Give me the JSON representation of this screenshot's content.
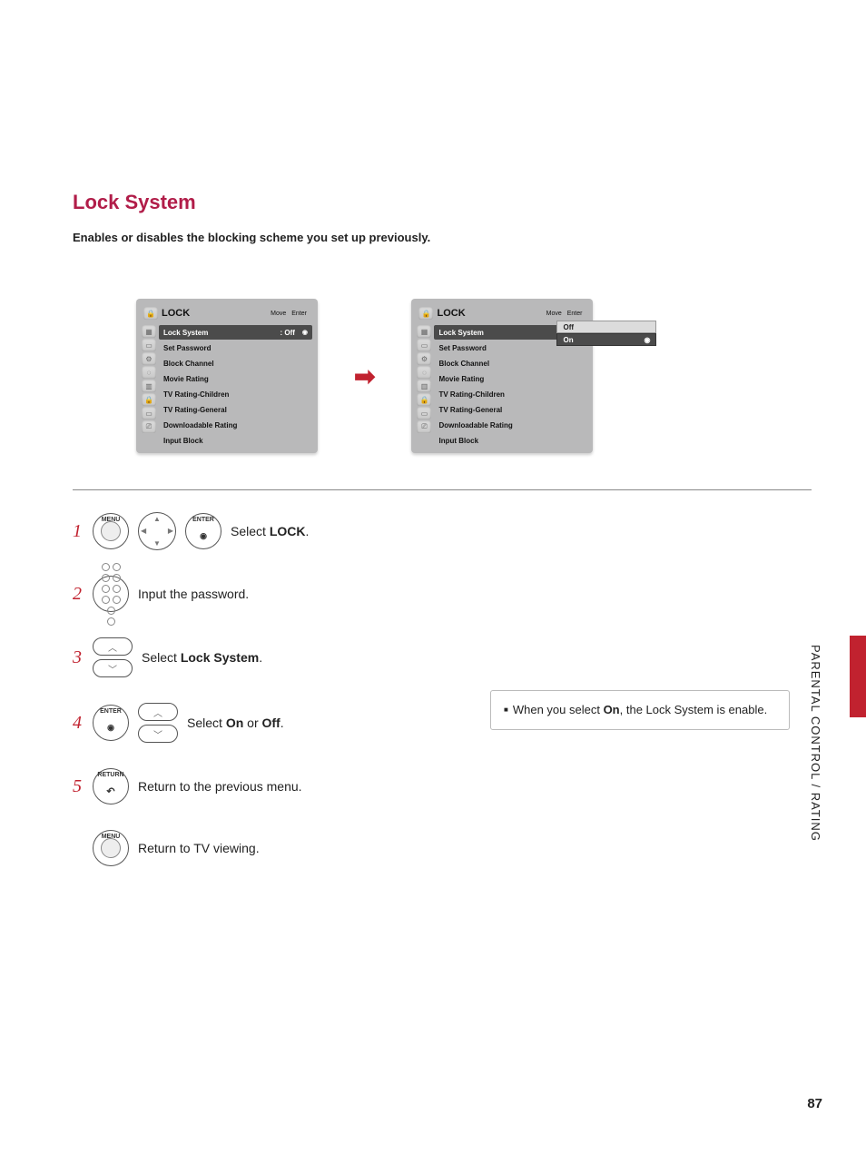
{
  "title": "Lock System",
  "subtitle": "Enables or disables the blocking scheme you set up previously.",
  "side_label": "PARENTAL CONTROL / RATING",
  "page_number": "87",
  "arrow_glyph": "➡",
  "osd": {
    "header": "LOCK",
    "hint_move": "Move",
    "hint_enter": "Enter",
    "items": [
      "Lock System",
      "Set Password",
      "Block Channel",
      "Movie Rating",
      "TV Rating-Children",
      "TV Rating-General",
      "Downloadable Rating",
      "Input Block"
    ],
    "lock_value": ": Off",
    "popup_off": "Off",
    "popup_on": "On"
  },
  "buttons": {
    "menu": "MENU",
    "enter": "ENTER",
    "return": "RETURN"
  },
  "steps": {
    "s1_num": "1",
    "s1_prefix": "Select ",
    "s1_bold": "LOCK",
    "s1_suffix": ".",
    "s2_num": "2",
    "s2_text": "Input the password.",
    "s3_num": "3",
    "s3_prefix": "Select ",
    "s3_bold": "Lock System",
    "s3_suffix": ".",
    "s4_num": "4",
    "s4_prefix": "Select ",
    "s4_bold1": "On",
    "s4_mid": " or ",
    "s4_bold2": "Off",
    "s4_suffix": ".",
    "s5_num": "5",
    "s5_text": "Return to the previous menu.",
    "s6_text": "Return to TV viewing."
  },
  "note": {
    "prefix": "When you select ",
    "bold": "On",
    "suffix": ", the Lock System is enable."
  }
}
